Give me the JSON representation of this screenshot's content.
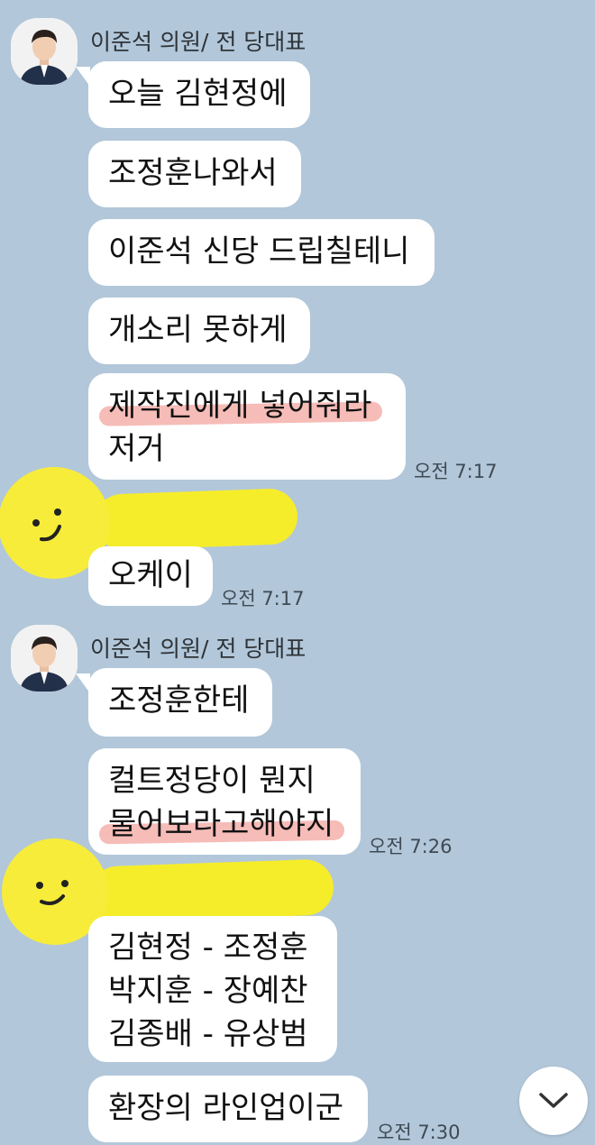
{
  "colors": {
    "background": "#b2c7d9",
    "bubble": "#ffffff",
    "highlight": "#f3a6a0",
    "redaction": "#f6ed2a"
  },
  "group1": {
    "sender": "이준석 의원/ 전 당대표",
    "messages": [
      "오늘 김현정에",
      "조정훈나와서",
      "이준석 신당 드립칠테니",
      "개소리 못하게"
    ],
    "last_message": {
      "line1": "제작진에게 넣어줘라",
      "line2": "저거"
    },
    "time": "오전 7:17"
  },
  "reply1": {
    "avatar_icon": "smiley-icon",
    "message": "오케이",
    "time": "오전 7:17"
  },
  "group2": {
    "sender": "이준석 의원/ 전 당대표",
    "message1": "조정훈한테",
    "message2": {
      "line1": "컬트정당이 뭔지",
      "line2": "물어보라고해야지"
    },
    "time": "오전 7:26"
  },
  "reply2": {
    "avatar_icon": "smiley-icon",
    "lineup": [
      "김현정 - 조정훈",
      "박지훈 - 장예찬",
      "김종배 - 유상범"
    ],
    "last_message": "환장의 라인업이군",
    "time": "오전 7:30"
  },
  "scroll_button": {
    "icon": "chevron-down-icon"
  }
}
